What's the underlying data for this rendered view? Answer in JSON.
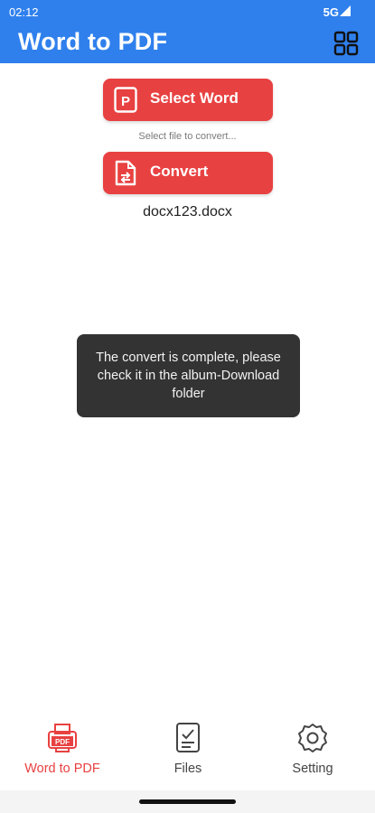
{
  "status": {
    "time": "02:12",
    "network": "5G"
  },
  "appbar": {
    "title": "Word to PDF",
    "grid_icon": "grid-icon"
  },
  "actions": {
    "select_label": "Select Word",
    "hint": "Select file to convert...",
    "convert_label": "Convert",
    "filename": "docx123.docx"
  },
  "toast": {
    "message": "The convert is complete, please check it in the album-Download folder"
  },
  "nav": {
    "items": [
      {
        "label": "Word to PDF",
        "icon": "pdf-printer-icon",
        "active": true
      },
      {
        "label": "Files",
        "icon": "files-icon",
        "active": false
      },
      {
        "label": "Setting",
        "icon": "gear-icon",
        "active": false
      }
    ]
  },
  "colors": {
    "primary": "#2F80ED",
    "accent": "#E84141",
    "toast_bg": "#333333"
  }
}
